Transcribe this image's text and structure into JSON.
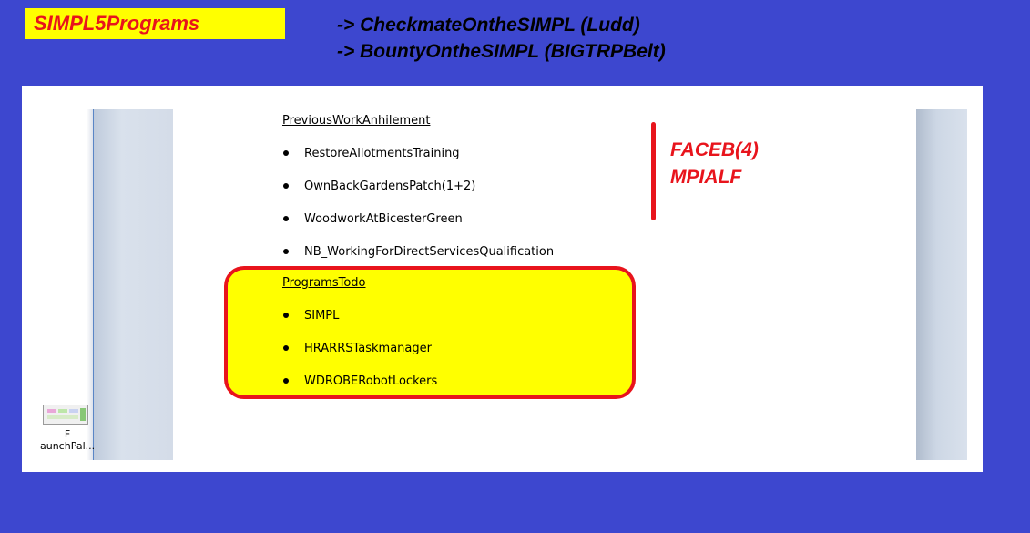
{
  "header": {
    "title": "SIMPL5Programs",
    "notes": [
      "-> CheckmateOntheSIMPL (Ludd)",
      "-> BountyOntheSIMPL (BIGTRPBelt)"
    ]
  },
  "document": {
    "previous_work": {
      "heading": "PreviousWorkAnhilement",
      "items": [
        "RestoreAllotmentsTraining",
        "OwnBackGardensPatch(1+2)",
        "WoodworkAtBicesterGreen",
        "NB_WorkingForDirectServicesQualification"
      ]
    },
    "programs_todo": {
      "heading": "ProgramsTodo",
      "items": [
        "SIMPL",
        "HRARRSTaskmanager",
        "WDROBERobotLockers"
      ]
    },
    "side_note": [
      "FACEB(4)",
      "MPIALF"
    ]
  },
  "desktop_icon": {
    "label_line1": "F",
    "label_line2": "aunchPal..."
  },
  "colors": {
    "background": "#3d47cf",
    "highlight": "#ffff00",
    "accent_red": "#e8141c"
  }
}
